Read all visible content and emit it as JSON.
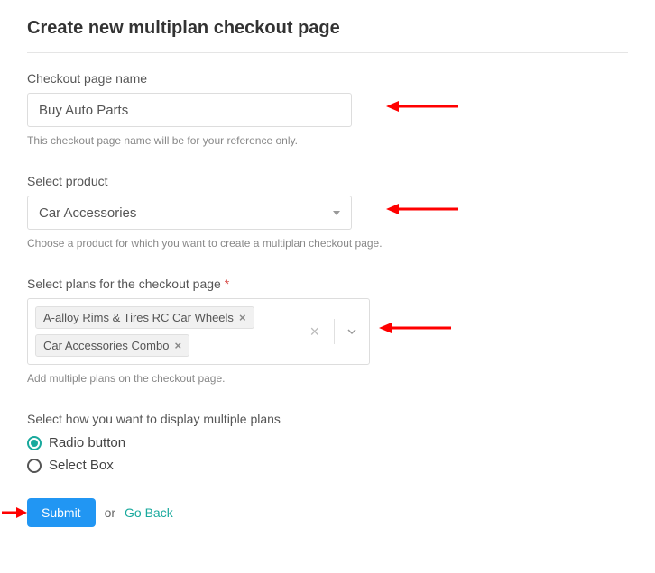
{
  "title": "Create new multiplan checkout page",
  "fields": {
    "name": {
      "label": "Checkout page name",
      "value": "Buy Auto Parts",
      "helper": "This checkout page name will be for your reference only."
    },
    "product": {
      "label": "Select product",
      "selected": "Car Accessories",
      "helper": "Choose a product for which you want to create a multiplan checkout page."
    },
    "plans": {
      "label": "Select plans for the checkout page",
      "required": "*",
      "tags": [
        "A-alloy Rims & Tires RC Car Wheels",
        "Car Accessories Combo"
      ],
      "helper": "Add multiple plans on the checkout page."
    },
    "display": {
      "label": "Select how you want to display multiple plans",
      "options": [
        "Radio button",
        "Select Box"
      ],
      "selected": 0
    }
  },
  "actions": {
    "submit": "Submit",
    "or": "or",
    "goback": "Go Back"
  }
}
